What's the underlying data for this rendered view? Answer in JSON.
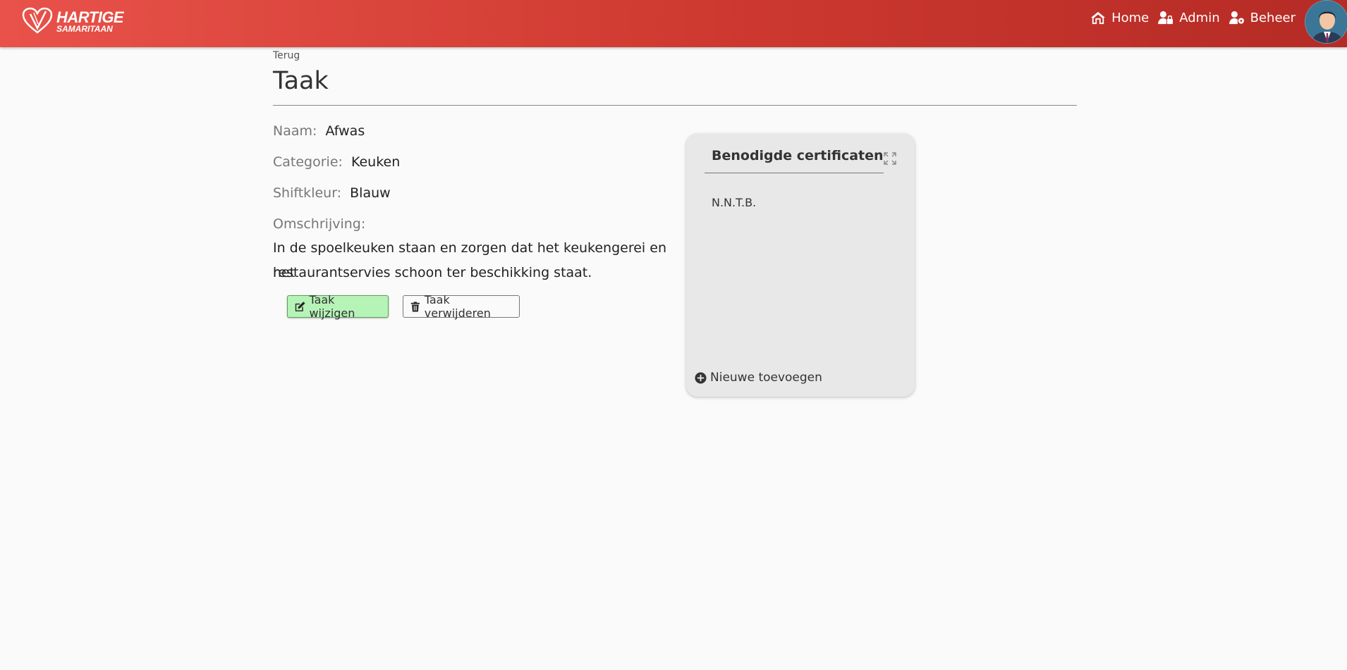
{
  "header": {
    "logo_line1": "HARTIGE",
    "logo_line2": "SAMARITAAN",
    "nav": [
      {
        "label": "Home",
        "icon": "home-icon"
      },
      {
        "label": "Admin",
        "icon": "user-lock-icon"
      },
      {
        "label": "Beheer",
        "icon": "user-cog-icon"
      }
    ],
    "colors": {
      "gradient_start": "#e8524a",
      "gradient_end": "#b52b25"
    }
  },
  "page": {
    "back_label": "Terug",
    "title": "Taak"
  },
  "task": {
    "name_label": "Naam:",
    "name_value": "Afwas",
    "category_label": "Categorie:",
    "category_value": "Keuken",
    "shift_color_label": "Shiftkleur:",
    "shift_color_value": "Blauw",
    "description_label": "Omschrijving:",
    "description_line1": "In de spoelkeuken staan en zorgen dat het keukengerei en het",
    "description_line2": "restaurantservies schoon ter beschikking staat."
  },
  "actions": {
    "edit_label": "Taak wijzigen",
    "delete_label": "Taak verwijderen"
  },
  "certificates": {
    "title": "Benodigde certificaten",
    "items": [
      "N.N.T.B."
    ],
    "add_label": "Nieuwe toevoegen"
  }
}
